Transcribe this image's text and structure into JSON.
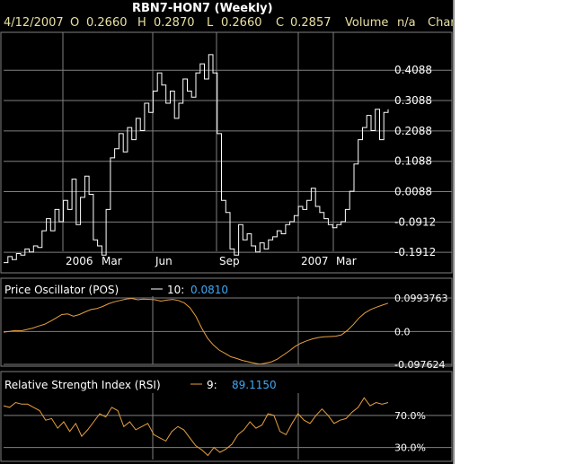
{
  "header": {
    "title": "RBN7-HON7 (Weekly)",
    "date": "4/12/2007",
    "open_label": "O",
    "open_value": "0.2660",
    "high_label": "H",
    "high_value": "0.2870",
    "low_label": "L",
    "low_value": "0.2660",
    "close_label": "C",
    "close_value": "0.2857",
    "volume_label": "Volume",
    "volume_value": "n/a",
    "trailing": "Char"
  },
  "colors": {
    "background": "#000000",
    "price": "#ffffff",
    "indicator": "#e8a040",
    "indicator_value": "#3fa9f5",
    "header_text": "#e8e0a0",
    "grid": "#808080"
  },
  "chart_data": [
    {
      "type": "line",
      "name": "price",
      "title": "RBN7-HON7 (Weekly)",
      "x_tick_labels": [
        "2006",
        "Mar",
        "Jun",
        "Sep",
        "2007",
        "Mar"
      ],
      "y_tick_labels": [
        "0.4088",
        "0.3088",
        "0.2088",
        "0.1088",
        "0.0088",
        "-0.0912",
        "-0.1912"
      ],
      "y_ticks": [
        0.4088,
        0.3088,
        0.2088,
        0.1088,
        0.0088,
        -0.0912,
        -0.1912
      ],
      "ylim": [
        -0.235,
        0.51
      ],
      "grid": true,
      "values": [
        -0.225,
        -0.205,
        -0.215,
        -0.195,
        -0.2,
        -0.18,
        -0.19,
        -0.17,
        -0.175,
        -0.12,
        -0.08,
        -0.12,
        -0.05,
        -0.09,
        -0.02,
        -0.05,
        0.05,
        -0.1,
        -0.01,
        0.06,
        0.0,
        -0.15,
        -0.17,
        -0.2,
        -0.05,
        0.12,
        0.15,
        0.2,
        0.14,
        0.22,
        0.18,
        0.25,
        0.21,
        0.3,
        0.27,
        0.34,
        0.4,
        0.36,
        0.3,
        0.34,
        0.25,
        0.3,
        0.38,
        0.34,
        0.32,
        0.4,
        0.43,
        0.38,
        0.46,
        0.4,
        0.2,
        -0.02,
        -0.06,
        -0.18,
        -0.2,
        -0.1,
        -0.15,
        -0.13,
        -0.17,
        -0.19,
        -0.16,
        -0.18,
        -0.15,
        -0.14,
        -0.12,
        -0.13,
        -0.1,
        -0.09,
        -0.07,
        -0.04,
        -0.05,
        -0.02,
        0.02,
        -0.04,
        -0.06,
        -0.08,
        -0.1,
        -0.11,
        -0.1,
        -0.09,
        -0.05,
        0.01,
        0.1,
        0.18,
        0.22,
        0.26,
        0.21,
        0.28,
        0.18,
        0.27,
        0.28
      ]
    },
    {
      "type": "line",
      "name": "oscillator",
      "title": "Price Oscillator (POS)",
      "param_label": "10:",
      "current_value": "0.0810",
      "y_tick_labels": [
        "0.0993763",
        "0.0",
        "-0.097624"
      ],
      "y_ticks": [
        0.0993763,
        0.0,
        -0.097624
      ],
      "ylim": [
        -0.097624,
        0.0993763
      ],
      "grid": true,
      "values": [
        -0.002,
        0.0,
        0.003,
        0.002,
        0.006,
        0.01,
        0.016,
        0.021,
        0.03,
        0.04,
        0.05,
        0.052,
        0.045,
        0.05,
        0.058,
        0.065,
        0.068,
        0.074,
        0.082,
        0.088,
        0.092,
        0.096,
        0.098,
        0.094,
        0.096,
        0.095,
        0.094,
        0.09,
        0.093,
        0.095,
        0.092,
        0.085,
        0.07,
        0.045,
        0.01,
        -0.02,
        -0.04,
        -0.055,
        -0.065,
        -0.075,
        -0.08,
        -0.086,
        -0.09,
        -0.094,
        -0.097,
        -0.094,
        -0.09,
        -0.082,
        -0.07,
        -0.058,
        -0.045,
        -0.035,
        -0.028,
        -0.022,
        -0.018,
        -0.016,
        -0.015,
        -0.014,
        -0.01,
        0.003,
        0.02,
        0.04,
        0.055,
        0.065,
        0.072,
        0.078,
        0.084
      ]
    },
    {
      "type": "line",
      "name": "rsi",
      "title": "Relative Strength Index (RSI)",
      "param_label": "9:",
      "current_value": "89.1150",
      "y_tick_labels": [
        "70.0%",
        "30.0%"
      ],
      "y_ticks": [
        70,
        30
      ],
      "ylim": [
        15,
        100
      ],
      "grid": true,
      "values": [
        82,
        80,
        86,
        84,
        84,
        80,
        76,
        64,
        66,
        54,
        62,
        50,
        60,
        44,
        52,
        62,
        72,
        68,
        80,
        76,
        56,
        62,
        52,
        56,
        60,
        46,
        42,
        38,
        50,
        56,
        52,
        42,
        32,
        27,
        20,
        30,
        24,
        28,
        34,
        46,
        52,
        62,
        54,
        58,
        72,
        70,
        50,
        46,
        60,
        72,
        64,
        60,
        70,
        78,
        70,
        60,
        64,
        66,
        74,
        80,
        92,
        82,
        86,
        84,
        86
      ]
    }
  ]
}
